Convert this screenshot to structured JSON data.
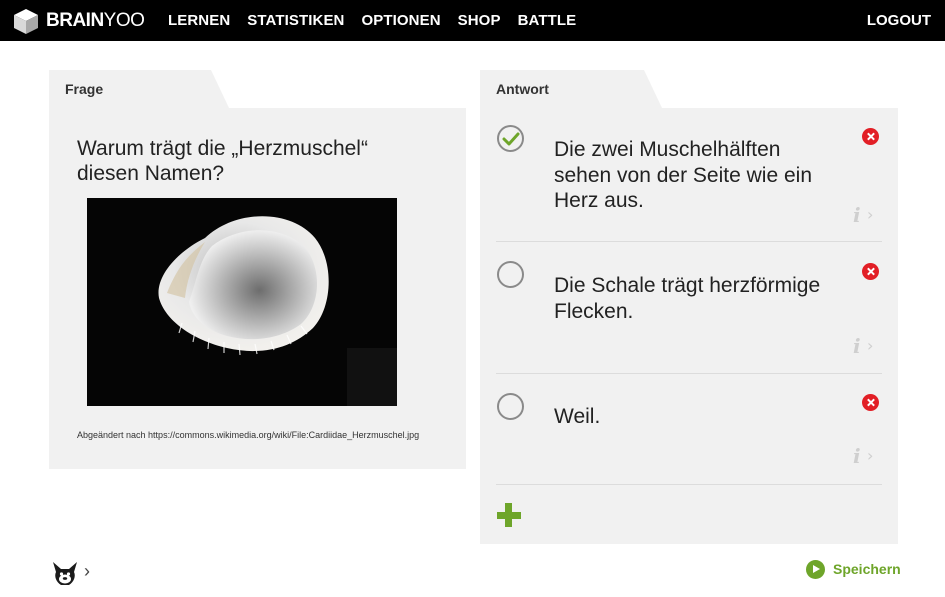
{
  "brand": {
    "logo_bold": "BRAIN",
    "logo_light": "YOO"
  },
  "nav": {
    "items": [
      "LERNEN",
      "STATISTIKEN",
      "OPTIONEN",
      "SHOP",
      "BATTLE"
    ],
    "logout": "LOGOUT"
  },
  "question": {
    "tab_label": "Frage",
    "text": "Warum trägt die „Herzmuschel“ diesen Namen?",
    "image_icon": "shell-photo",
    "caption": "Abgeändert nach https://commons.wikimedia.org/wiki/File:Cardiidae_Herzmuschel.jpg"
  },
  "answer": {
    "tab_label": "Antwort",
    "options": [
      {
        "text": "Die zwei Muschelhälften sehen von der Seite wie ein Herz aus.",
        "correct": true
      },
      {
        "text": "Die Schale trägt herzförmige Flecken.",
        "correct": false
      },
      {
        "text": "Weil.",
        "correct": false
      }
    ],
    "info_glyph": "i",
    "info_chevron": "›"
  },
  "footer": {
    "mascot_chevron": "›",
    "save_label": "Speichern"
  },
  "colors": {
    "nav_bg": "#000000",
    "panel_bg": "#f1f1f1",
    "accent_green": "#6ea52a",
    "delete_red": "#e21f26"
  }
}
